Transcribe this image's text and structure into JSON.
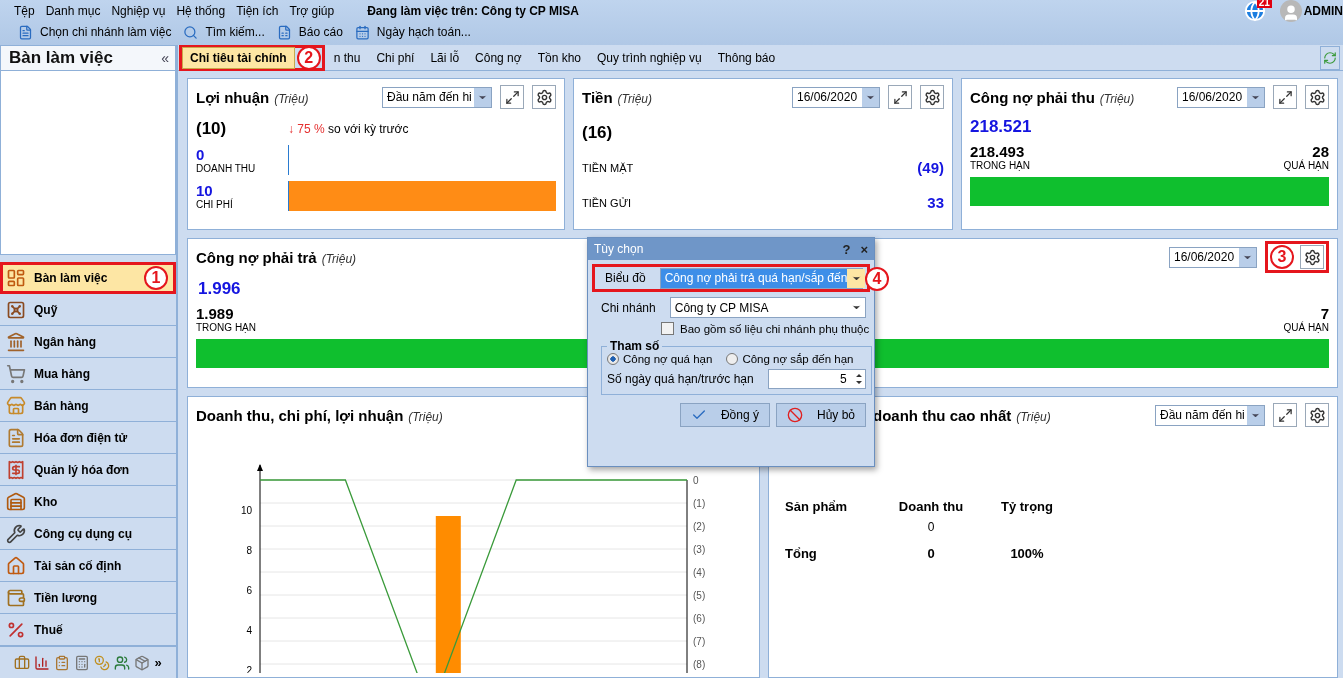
{
  "menu": [
    "Tệp",
    "Danh mục",
    "Nghiệp vụ",
    "Hệ thống",
    "Tiện ích",
    "Trợ giúp"
  ],
  "working_on": "Đang làm việc trên:  Công ty CP MISA",
  "toolbar": [
    "Chọn chi nhánh làm việc",
    "Tìm kiếm...",
    "Báo cáo",
    "Ngày hạch toán..."
  ],
  "user": {
    "notifications": "21",
    "name": "ADMIN"
  },
  "sidebar": {
    "title": "Bàn làm việc",
    "collapse": "«",
    "more": "»",
    "items": [
      {
        "label": "Bàn làm việc",
        "selected": true,
        "annotation": "1"
      },
      {
        "label": "Quỹ",
        "selected": false
      },
      {
        "label": "Ngân hàng",
        "selected": false
      },
      {
        "label": "Mua hàng",
        "selected": false
      },
      {
        "label": "Bán hàng",
        "selected": false
      },
      {
        "label": "Hóa đơn điện tử",
        "selected": false
      },
      {
        "label": "Quản lý hóa đơn",
        "selected": false
      },
      {
        "label": "Kho",
        "selected": false
      },
      {
        "label": "Công cụ dụng cụ",
        "selected": false
      },
      {
        "label": "Tài sản cố định",
        "selected": false
      },
      {
        "label": "Tiền lương",
        "selected": false
      },
      {
        "label": "Thuế",
        "selected": false
      }
    ]
  },
  "tabs": [
    {
      "label": "Chỉ tiêu tài chính",
      "selected": true,
      "annotation": "2"
    },
    {
      "label": "n thu",
      "selected": false
    },
    {
      "label": "Chi phí",
      "selected": false
    },
    {
      "label": "Lãi lỗ",
      "selected": false
    },
    {
      "label": "Công nợ",
      "selected": false
    },
    {
      "label": "Tồn kho",
      "selected": false
    },
    {
      "label": "Quy trình nghiệp vụ",
      "selected": false
    },
    {
      "label": "Thông báo",
      "selected": false
    }
  ],
  "profit": {
    "title": "Lợi nhuận",
    "unit": "(Triệu)",
    "period": "Đầu năm đến hi",
    "total": "(10)",
    "change_arrow": "↓",
    "change": "75 %",
    "change_text": "so với kỳ trước",
    "bars": [
      {
        "value": "0",
        "label": "DOANH THU",
        "level": 0
      },
      {
        "value": "10",
        "label": "CHI PHÍ",
        "level": 1
      }
    ]
  },
  "cash": {
    "title": "Tiền",
    "unit": "(Triệu)",
    "date": "16/06/2020",
    "total": "(16)",
    "rows": [
      {
        "label": "TIỀN MẶT",
        "value": "(49)"
      },
      {
        "label": "TIỀN GỬI",
        "value": "33"
      }
    ]
  },
  "receivable": {
    "title": "Công nợ phải thu",
    "unit": "(Triệu)",
    "date": "16/06/2020",
    "total": "218.521",
    "in_term": "218.493",
    "in_term_label": "TRONG HẠN",
    "overdue": "28",
    "overdue_label": "QUÁ HẠN",
    "level": 1
  },
  "payable": {
    "title": "Công nợ phải trả",
    "unit": "(Triệu)",
    "date": "16/06/2020",
    "annotation": "3",
    "total": "1.996",
    "in_term": "1.989",
    "in_term_label": "TRONG HẠN",
    "overdue": "7",
    "overdue_label": "QUÁ HẠN",
    "level": 1
  },
  "chart_card": {
    "title": "Doanh thu, chi phí, lợi nhuận",
    "unit": "(Triệu)",
    "chart_data": {
      "type": "bar",
      "grid": true,
      "ylim": [
        0,
        12.3
      ],
      "y2lim": [
        -10.7,
        0
      ],
      "yticks": [
        2,
        4,
        6,
        8,
        10
      ],
      "series": [
        {
          "type": "bar",
          "color": "#ff8c00",
          "values": [
            null,
            null,
            9.7,
            null,
            null,
            null
          ]
        },
        {
          "type": "line",
          "color": "#3a9a3a",
          "values": [
            11.5,
            11.5,
            0,
            11.5,
            11.5,
            11.5
          ]
        }
      ],
      "y2ticks": [
        {
          "value": 0,
          "label": "0"
        },
        {
          "value": -1,
          "label": "(1)"
        },
        {
          "value": -2,
          "label": "(2)"
        },
        {
          "value": -3,
          "label": "(3)"
        },
        {
          "value": -4,
          "label": "(4)"
        },
        {
          "value": -5,
          "label": "(5)"
        },
        {
          "value": -6,
          "label": "(6)"
        },
        {
          "value": -7,
          "label": "(7)"
        },
        {
          "value": -8,
          "label": "(8)"
        }
      ]
    }
  },
  "top_products": {
    "title": "doanh thu cao nhất",
    "unit": "(Triệu)",
    "period": "Đầu năm đến hi",
    "columns": [
      "Sản phẩm",
      "Doanh thu",
      "Tỷ trọng"
    ],
    "rows": [
      {
        "revenue": "0"
      }
    ],
    "total": [
      "Tổng",
      "0",
      "100%"
    ]
  },
  "dialog": {
    "title": "Tùy chọn",
    "help": "?",
    "close": "×",
    "chart_label": "Biểu đồ",
    "chart_value": "Công nợ phải trả quá hạn/sắp đến",
    "annotation": "4",
    "branch_label": "Chi nhánh",
    "branch_value": "Công ty CP MISA",
    "include_label": "Bao gồm số liệu chi nhánh phụ thuộc",
    "include_checked": false,
    "group": "Tham số",
    "radios": [
      {
        "label": "Công nợ quá hạn",
        "selected": true
      },
      {
        "label": "Công nợ sắp đến hạn",
        "selected": false
      }
    ],
    "days_label": "Số ngày quá hạn/trước hạn",
    "days_value": "5",
    "buttons": [
      {
        "kind": "ok",
        "label": "Đồng ý"
      },
      {
        "kind": "cancel",
        "label": "Hủy bỏ"
      }
    ]
  }
}
